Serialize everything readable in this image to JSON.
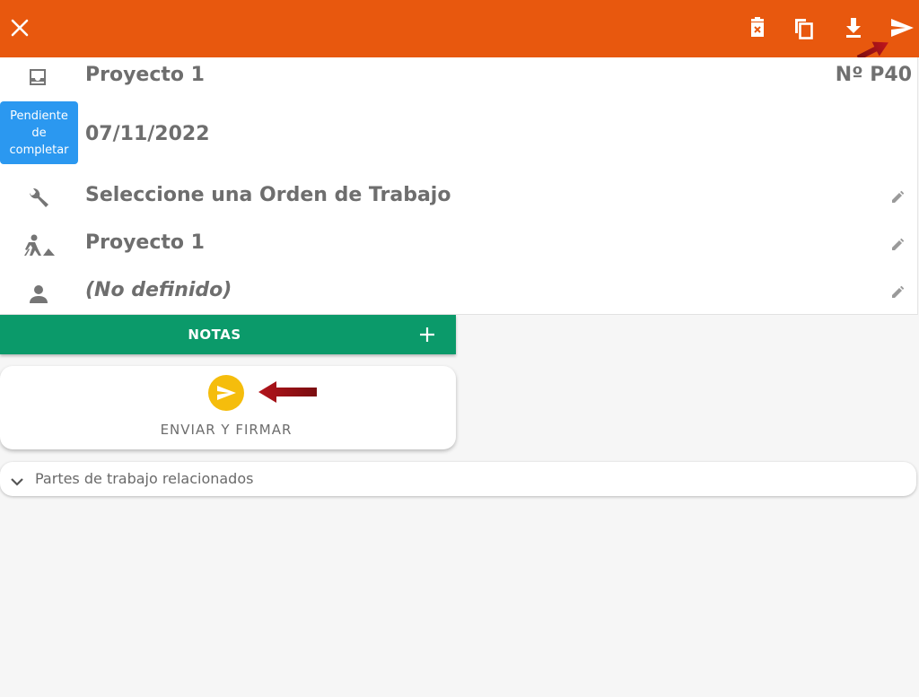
{
  "colors": {
    "header": "#e8580e",
    "status_badge": "#2b98f0",
    "notas_bar": "#0b9a6a",
    "send_button": "#f5bd0c",
    "annotation_arrow": "#b3141b"
  },
  "header": {
    "icons": [
      "close-icon",
      "delete-icon",
      "copy-icon",
      "download-icon",
      "send-icon"
    ]
  },
  "document": {
    "project_name": "Proyecto 1",
    "number": "Nº P40",
    "status": [
      "Pendiente",
      "de",
      "completar"
    ],
    "date": "07/11/2022"
  },
  "fields": {
    "work_order": "Seleccione una Orden de Trabajo",
    "project": "Proyecto 1",
    "assignee": "(No definido)"
  },
  "notas": {
    "label": "NOTAS"
  },
  "send_card": {
    "label": "ENVIAR Y FIRMAR"
  },
  "related": {
    "label": "Partes de trabajo relacionados"
  }
}
